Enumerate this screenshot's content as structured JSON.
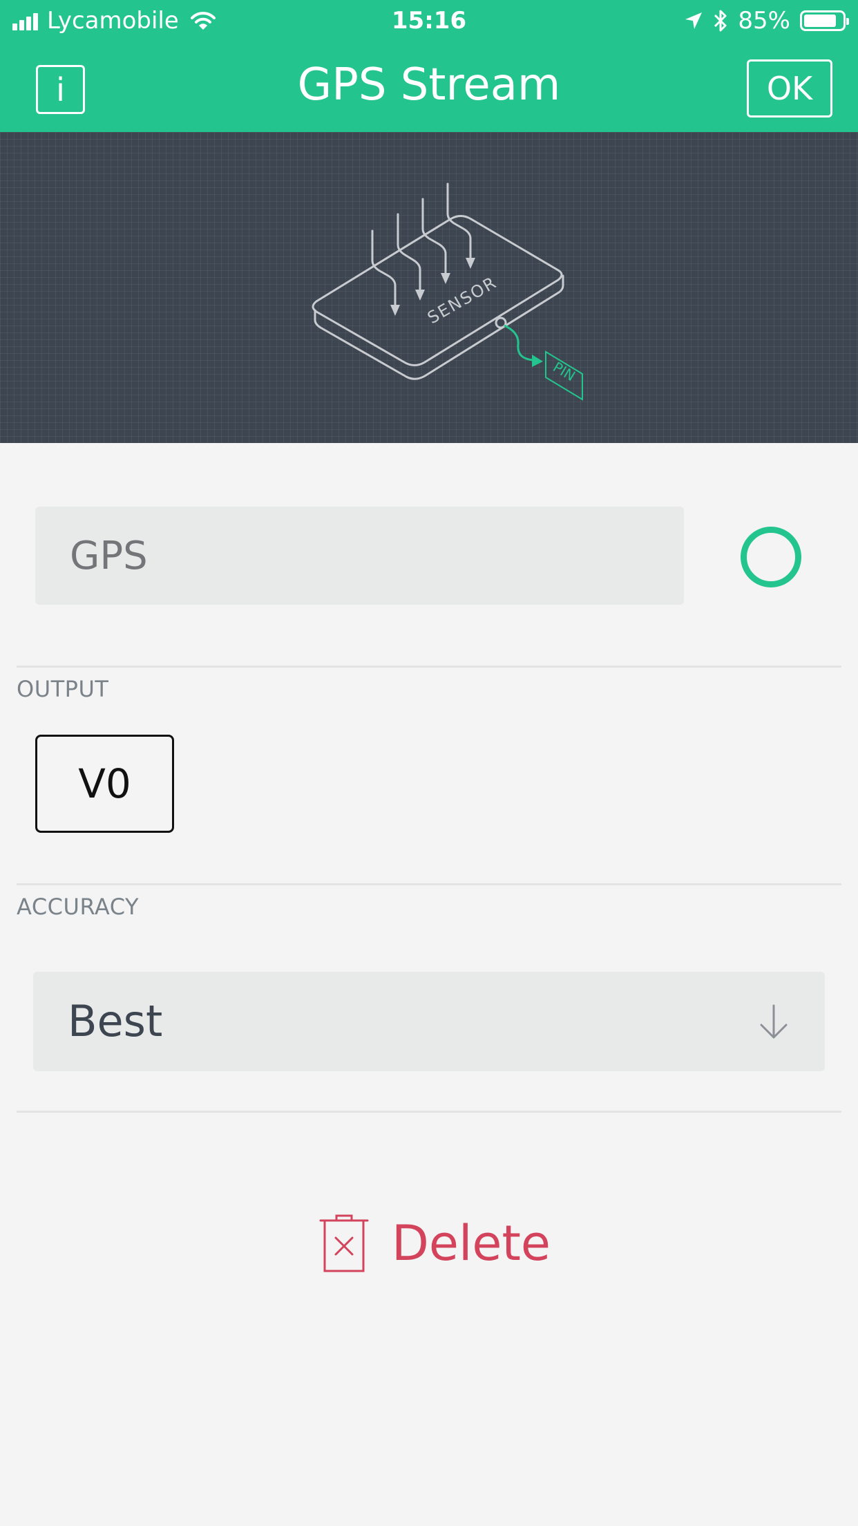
{
  "status_bar": {
    "carrier": "Lycamobile",
    "time": "15:16",
    "battery": "85%",
    "battery_level": 0.85
  },
  "header": {
    "title": "GPS Stream",
    "info_label": "i",
    "ok_label": "OK"
  },
  "illustration": {
    "sensor_label": "SENSOR",
    "pin_label": "PIN"
  },
  "name_field": {
    "value": "GPS"
  },
  "output": {
    "label": "OUTPUT",
    "pin_value": "V0"
  },
  "accuracy": {
    "label": "ACCURACY",
    "selected": "Best"
  },
  "actions": {
    "delete_label": "Delete"
  },
  "colors": {
    "accent": "#23c48e",
    "danger": "#d3435c",
    "illustration_bg": "#3d4550"
  }
}
